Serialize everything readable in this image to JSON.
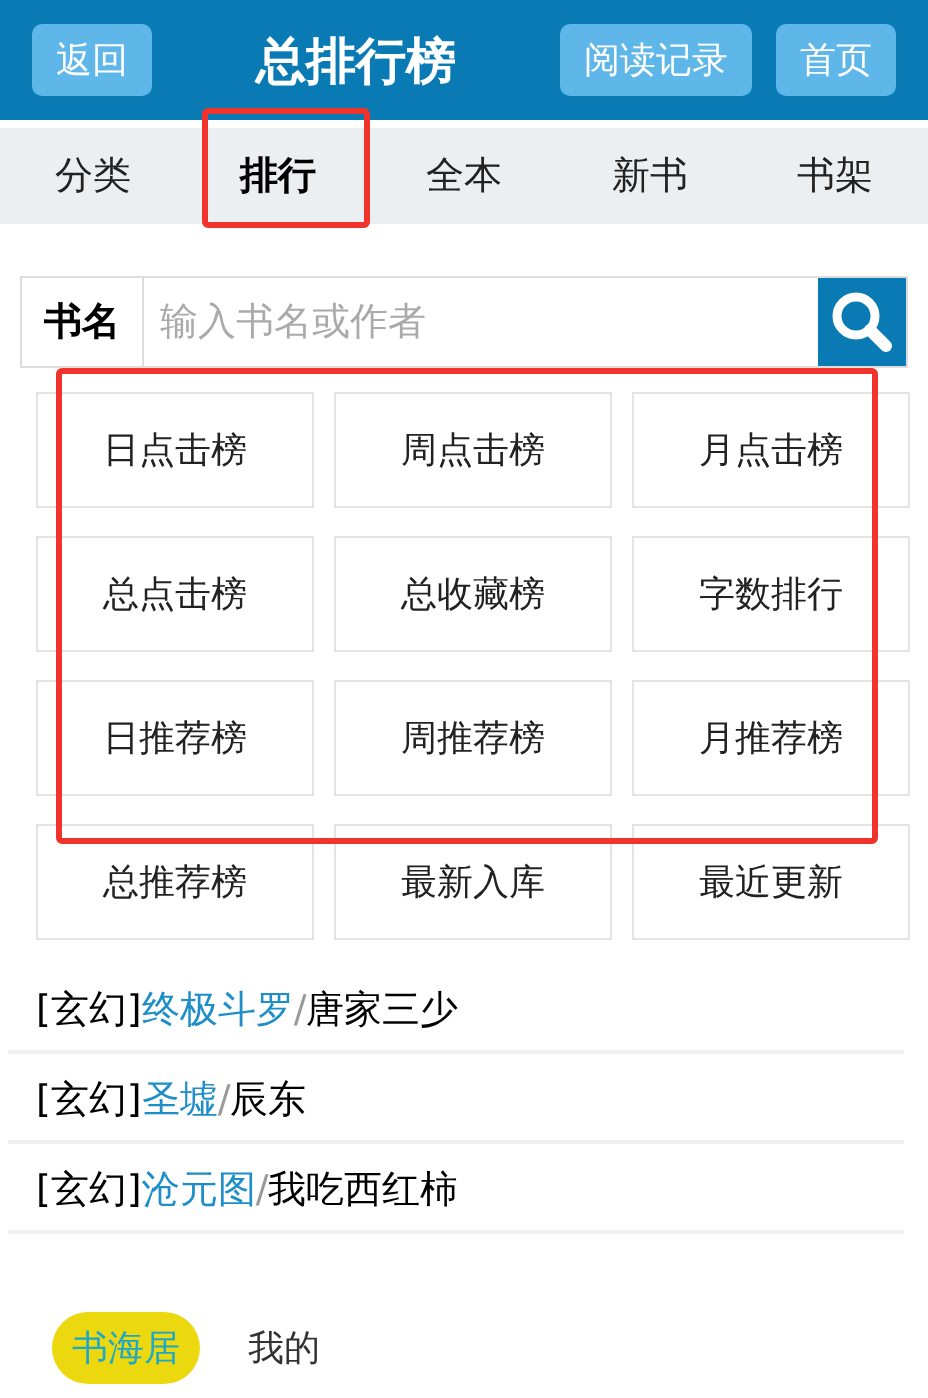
{
  "header": {
    "back": "返回",
    "title": "总排行榜",
    "history": "阅读记录",
    "home": "首页"
  },
  "nav": [
    {
      "label": "分类",
      "selected": false,
      "annotated": false
    },
    {
      "label": "排行",
      "selected": true,
      "annotated": true
    },
    {
      "label": "全本",
      "selected": false,
      "annotated": false
    },
    {
      "label": "新书",
      "selected": false,
      "annotated": false
    },
    {
      "label": "书架",
      "selected": false,
      "annotated": false
    }
  ],
  "search": {
    "label": "书名",
    "placeholder": "输入书名或作者"
  },
  "rankings": [
    {
      "annotated": true,
      "items": [
        "日点击榜",
        "周点击榜",
        "月点击榜"
      ]
    },
    {
      "annotated": true,
      "items": [
        "总点击榜",
        "总收藏榜",
        "字数排行"
      ]
    },
    {
      "annotated": true,
      "items": [
        "日推荐榜",
        "周推荐榜",
        "月推荐榜"
      ]
    },
    {
      "annotated": false,
      "items": [
        "总推荐榜",
        "最新入库",
        "最近更新"
      ]
    }
  ],
  "books": [
    {
      "genre": "[玄幻]",
      "title": "终极斗罗",
      "separator": "/",
      "author": "唐家三少"
    },
    {
      "genre": "[玄幻]",
      "title": "圣墟",
      "separator": "/",
      "author": "辰东"
    },
    {
      "genre": "[玄幻]",
      "title": "沧元图",
      "separator": "/",
      "author": "我吃西红柿"
    }
  ],
  "footer": [
    {
      "label": "书海居",
      "selected": true
    },
    {
      "label": "我的",
      "selected": false
    }
  ]
}
